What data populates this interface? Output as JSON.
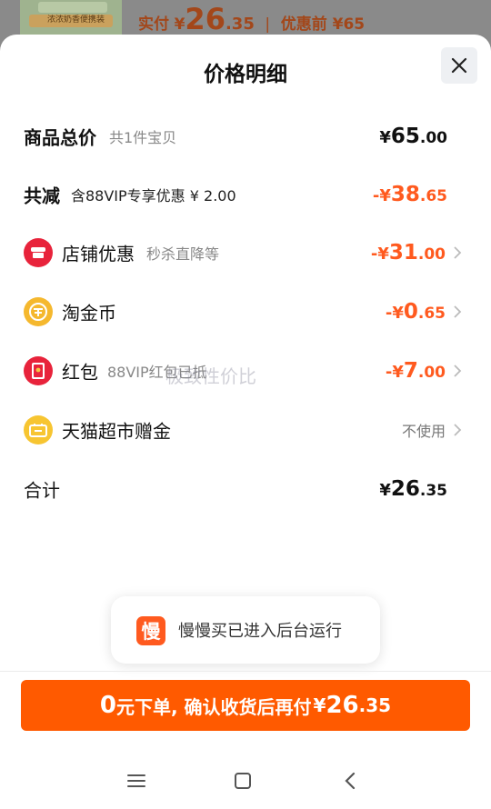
{
  "background": {
    "thumb_label": "浓浓奶香便携装",
    "price_label": "实付",
    "price_currency": "¥",
    "price_int": "26",
    "price_dec": ".35",
    "separator": "|",
    "original_price": "优惠前 ¥65"
  },
  "sheet": {
    "title": "价格明细"
  },
  "rows": {
    "total": {
      "label": "商品总价",
      "sub": "共1件宝贝",
      "cur": "¥",
      "int": "65",
      "dec": ".00"
    },
    "reduce": {
      "label": "共减",
      "sub": "含88VIP专享优惠 ¥ 2.00",
      "cur": "-¥",
      "int": "38",
      "dec": ".65"
    },
    "store": {
      "label": "店铺优惠",
      "sub": "秒杀直降等",
      "cur": "-¥",
      "int": "31",
      "dec": ".00"
    },
    "coin": {
      "label": "淘金币",
      "cur": "-¥",
      "int": "0",
      "dec": ".65"
    },
    "redpacket": {
      "label": "红包",
      "sub": "88VIP红包已抵",
      "cur": "-¥",
      "int": "7",
      "dec": ".00"
    },
    "tmall": {
      "label": "天猫超市赠金",
      "action": "不使用"
    },
    "sum": {
      "label": "合计",
      "cur": "¥",
      "int": "26",
      "dec": ".35"
    }
  },
  "watermark": "极致性价比",
  "toast": {
    "logo_char": "慢",
    "text": "慢慢买已进入后台运行"
  },
  "cta": {
    "n": "0",
    "t": "元下单, 确认收货后再付",
    "cur": "¥",
    "i": "26",
    "d": ".35"
  },
  "icons": {
    "close": "close-icon",
    "store": "store-icon",
    "coin": "coin-icon",
    "redpacket": "red-packet-icon",
    "tmall": "gift-card-icon",
    "chevron": "chevron-right-icon",
    "nav_menu": "menu-icon",
    "nav_home": "home-icon",
    "nav_back": "back-icon"
  },
  "colors": {
    "accent": "#ff5a00",
    "discount": "#ff5a1f",
    "store_icon": "#e8233b",
    "coin_icon": "#f5b82e",
    "redpacket_icon": "#e8233b",
    "tmall_icon": "#f7c531"
  }
}
